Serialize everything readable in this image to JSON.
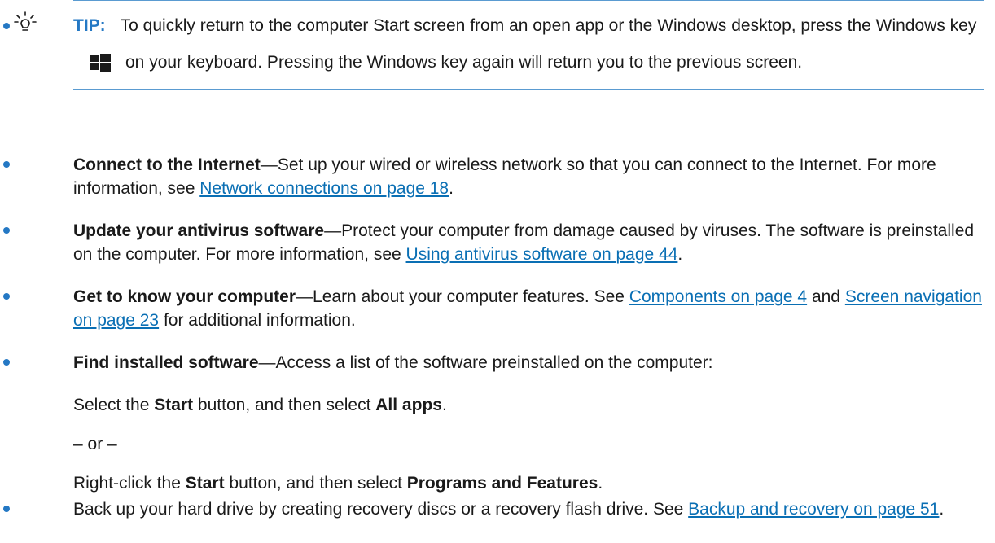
{
  "tip": {
    "label": "TIP:",
    "text_before_key": "To quickly return to the computer Start screen from an open app or the Windows desktop, press the Windows key",
    "text_after_key": "on your keyboard. Pressing the Windows key again will return you to the previous screen.",
    "icon": "lightbulb-icon",
    "key_icon": "windows-logo-icon"
  },
  "items": [
    {
      "bold": "Connect to the Internet",
      "text": "—Set up your wired or wireless network so that you can connect to the Internet. For more information, see ",
      "link": "Network connections on page 18",
      "after": "."
    },
    {
      "bold": "Update your antivirus software",
      "text": "—Protect your computer from damage caused by viruses. The software is preinstalled on the computer. For more information, see ",
      "link": "Using antivirus software on page 44",
      "after": "."
    },
    {
      "bold": "Get to know your computer",
      "text": "—Learn about your computer features. See ",
      "link": "Components on page 4",
      "mid": " and ",
      "link2": "Screen navigation on page 23",
      "after": " for additional information."
    },
    {
      "bold": "Find installed software",
      "text": "—Access a list of the software preinstalled on the computer:"
    },
    {
      "text": "Back up your hard drive by creating recovery discs or a recovery flash drive. See ",
      "link": "Backup and recovery on page 51",
      "after": "."
    }
  ],
  "steps": {
    "step1_a": "Select the ",
    "step1_b": "Start",
    "step1_c": " button, and then select ",
    "step1_d": "All apps",
    "step1_e": ".",
    "or": "– or –",
    "step2_a": "Right-click the ",
    "step2_b": "Start",
    "step2_c": " button, and then select ",
    "step2_d": "Programs and Features",
    "step2_e": "."
  },
  "colors": {
    "accent": "#2478c4",
    "link": "#0a6fb4",
    "rule": "#5a9bd1",
    "text": "#1a1a1a"
  }
}
